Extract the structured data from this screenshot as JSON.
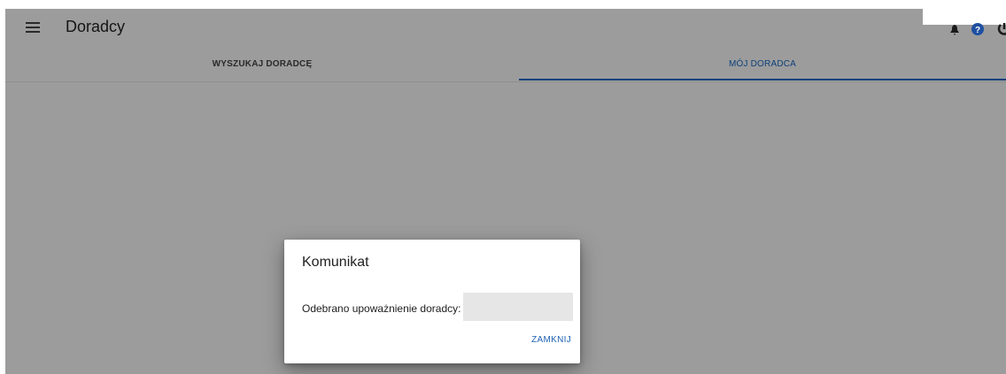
{
  "app_bar": {
    "title": "Doradcy",
    "menu_icon": "hamburger-menu-icon",
    "icons": [
      "bell-icon",
      "help-icon",
      "power-icon"
    ]
  },
  "tabs": [
    {
      "label": "WYSZUKAJ DORADCĘ",
      "active": false
    },
    {
      "label": "MÓJ DORADCA",
      "active": true
    }
  ],
  "dialog": {
    "title": "Komunikat",
    "message": "Odebrano upoważnienie doradcy:",
    "field_value": "",
    "close_label": "ZAMKNIJ"
  },
  "colors": {
    "accent": "#1565c0",
    "overlay": "rgba(0,0,0,0.36)",
    "app_background": "#f5f5f5"
  }
}
